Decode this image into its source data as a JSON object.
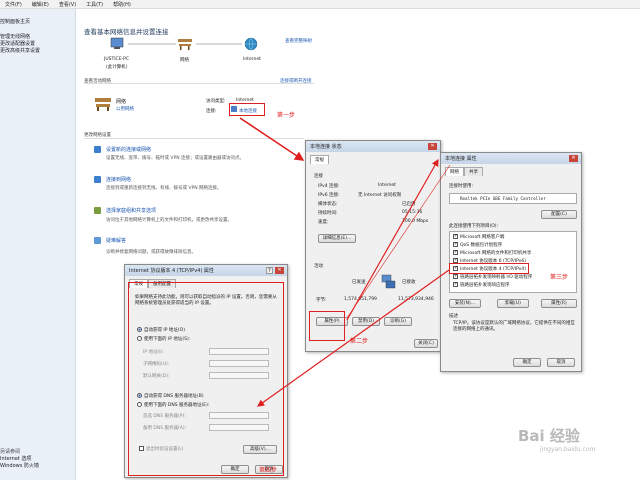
{
  "menu": [
    "文件(F)",
    "编辑(E)",
    "查看(V)",
    "工具(T)",
    "帮助(H)"
  ],
  "sidebar": {
    "home": "控制面板主页",
    "items": [
      "管理无线网络",
      "更改适配器设置",
      "更改高级共享设置"
    ],
    "see_also_title": "另请参阅",
    "see_also": [
      "Internet 选项",
      "Windows 防火墙"
    ]
  },
  "main": {
    "title": "查看基本网络信息并设置连接",
    "view_full_map": "查看完整映射",
    "map": {
      "pc": "JUSTICE-PC",
      "pc_sub": "(此计算机)",
      "network": "网络",
      "internet": "Internet"
    },
    "active_title": "查看活动网络",
    "connect_disconnect": "连接或断开连接",
    "network_name": "网络",
    "network_type": "公用网络",
    "access_type_label": "访问类型:",
    "access_type_value": "Internet",
    "connection_label": "连接:",
    "connection_value": "本地连接",
    "change_title": "更改网络设置",
    "tasks": [
      {
        "title": "设置新的连接或网络",
        "desc": "设置无线、宽带、拨号、临时或 VPN 连接；或设置路由器或访问点。"
      },
      {
        "title": "连接到网络",
        "desc": "连接到或重新连接到无线、有线、拨号或 VPN 网络连接。"
      },
      {
        "title": "选择家庭组和共享选项",
        "desc": "访问位于其他网络计算机上的文件和打印机，或更改共享设置。"
      },
      {
        "title": "疑难解答",
        "desc": "诊断并修复网络问题，或获得故障排除信息。"
      }
    ]
  },
  "status_dialog": {
    "title": "本地连接 状态",
    "tab": "常规",
    "connection_header": "连接",
    "rows": [
      {
        "label": "IPv4 连接:",
        "value": "Internet"
      },
      {
        "label": "IPv6 连接:",
        "value": "无 Internet 访问权限"
      },
      {
        "label": "媒体状态:",
        "value": "已启用"
      },
      {
        "label": "持续时间:",
        "value": "05:15:36"
      },
      {
        "label": "速度:",
        "value": "100.0 Mbps"
      }
    ],
    "details_btn": "详细信息(E)...",
    "activity_header": "活动",
    "sent": "已发送",
    "received": "已接收",
    "bytes_label": "字节:",
    "bytes_sent": "1,574,951,799",
    "bytes_received": "11,573,934,946",
    "properties_btn": "属性(P)",
    "disable_btn": "禁用(D)",
    "diagnose_btn": "诊断(G)",
    "close_btn": "关闭(C)"
  },
  "props_dialog": {
    "title": "本地连接 属性",
    "tabs": [
      "网络",
      "共享"
    ],
    "connect_using": "连接时使用:",
    "adapter": "Realtek PCIe GBE Family Controller",
    "configure_btn": "配置(C)",
    "items_label": "此连接使用下列项目(O):",
    "items": [
      "Microsoft 网络客户端",
      "QoS 数据包计划程序",
      "Microsoft 网络的文件和打印机共享",
      "Internet 协议版本 6 (TCP/IPv6)",
      "Internet 协议版本 4 (TCP/IPv4)",
      "链路层拓扑发现映射器 I/O 驱动程序",
      "链路层拓扑发现响应程序"
    ],
    "install_btn": "安装(N)...",
    "uninstall_btn": "卸载(U)",
    "properties_btn": "属性(R)",
    "desc_header": "描述",
    "desc": "TCP/IP。该协议是默认的广域网络协议，它提供在不同的相互连接的网络上的通讯。",
    "ok_btn": "确定",
    "cancel_btn": "取消"
  },
  "ipv4_dialog": {
    "title": "Internet 协议版本 4 (TCP/IPv4) 属性",
    "tabs": [
      "常规",
      "备用配置"
    ],
    "intro": "如果网络支持此功能，则可以获取自动指派的 IP 设置。否则，您需要从网络系统管理员处获得适当的 IP 设置。",
    "auto_ip": "自动获得 IP 地址(O)",
    "manual_ip": "使用下面的 IP 地址(S):",
    "ip_label": "IP 地址(I):",
    "mask_label": "子网掩码(U):",
    "gateway_label": "默认网关(D):",
    "auto_dns": "自动获得 DNS 服务器地址(B)",
    "manual_dns": "使用下面的 DNS 服务器地址(E):",
    "dns1_label": "首选 DNS 服务器(P):",
    "dns2_label": "备用 DNS 服务器(A):",
    "validate": "退出时验证设置(L)",
    "advanced_btn": "高级(V)...",
    "ok_btn": "确定",
    "cancel_btn": "取消"
  },
  "annotations": {
    "step1": "第一步",
    "step2": "第二步",
    "step3": "第三步",
    "step4": "第四步"
  },
  "watermark": {
    "brand": "Bai 经验",
    "url": "jingyan.baidu.com"
  }
}
